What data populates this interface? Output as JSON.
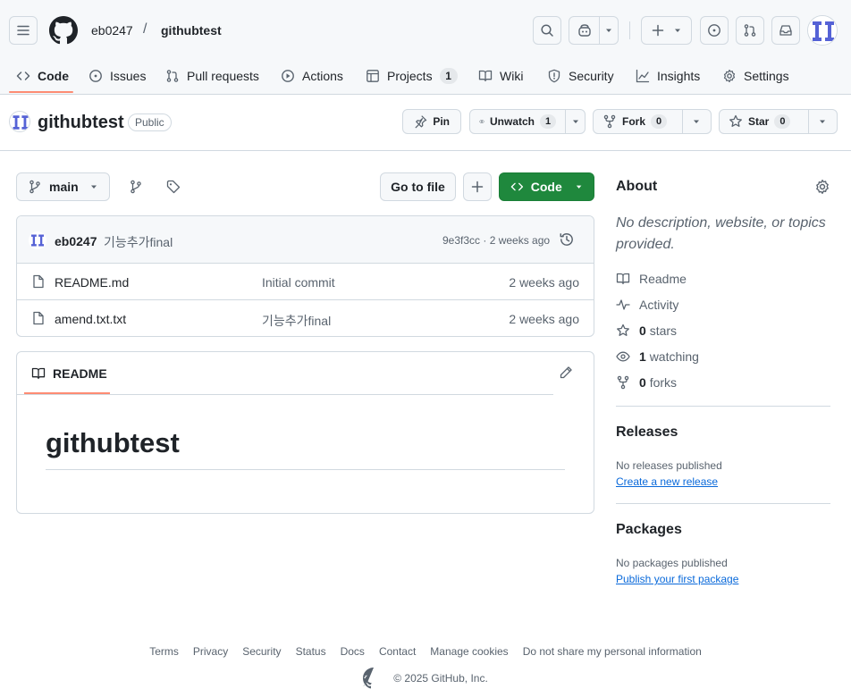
{
  "header": {
    "owner": "eb0247",
    "separator": "/",
    "repo": "githubtest"
  },
  "nav": {
    "items": [
      {
        "label": "Code",
        "icon": "code-icon"
      },
      {
        "label": "Issues",
        "icon": "issue-icon"
      },
      {
        "label": "Pull requests",
        "icon": "pull-request-icon"
      },
      {
        "label": "Actions",
        "icon": "play-icon"
      },
      {
        "label": "Projects",
        "icon": "table-icon",
        "count": "1"
      },
      {
        "label": "Wiki",
        "icon": "book-icon"
      },
      {
        "label": "Security",
        "icon": "shield-icon"
      },
      {
        "label": "Insights",
        "icon": "graph-icon"
      },
      {
        "label": "Settings",
        "icon": "gear-icon"
      }
    ]
  },
  "repo": {
    "name": "githubtest",
    "visibility": "Public",
    "pin_label": "Pin",
    "unwatch_label": "Unwatch",
    "watch_count": "1",
    "fork_label": "Fork",
    "fork_count": "0",
    "star_label": "Star",
    "star_count": "0"
  },
  "toolbar": {
    "branch": "main",
    "goto_label": "Go to file",
    "code_label": "Code"
  },
  "commit": {
    "author": "eb0247",
    "message": "기능추가final",
    "meta": "9e3f3cc · 2 weeks ago"
  },
  "files": [
    {
      "name": "README.md",
      "commit": "Initial commit",
      "age": "2 weeks ago"
    },
    {
      "name": "amend.txt.txt",
      "commit": "기능추가final",
      "age": "2 weeks ago"
    }
  ],
  "readme": {
    "tab_label": "README",
    "heading": "githubtest"
  },
  "about": {
    "title": "About",
    "description": "No description, website, or topics provided.",
    "readme_label": "Readme",
    "activity_label": "Activity",
    "stars_count": "0",
    "stars_label": "stars",
    "watching_count": "1",
    "watching_label": "watching",
    "forks_count": "0",
    "forks_label": "forks"
  },
  "releases": {
    "title": "Releases",
    "empty_text": "No releases published",
    "link": "Create a new release"
  },
  "packages": {
    "title": "Packages",
    "empty_text": "No packages published",
    "link": "Publish your first package"
  },
  "footer": {
    "links": [
      "Terms",
      "Privacy",
      "Security",
      "Status",
      "Docs",
      "Contact",
      "Manage cookies",
      "Do not share my personal information"
    ],
    "copyright": "© 2025 GitHub, Inc."
  },
  "colors": {
    "accent_underline": "#fd8c73",
    "primary_green": "#1f883d",
    "link_blue": "#0969da"
  }
}
